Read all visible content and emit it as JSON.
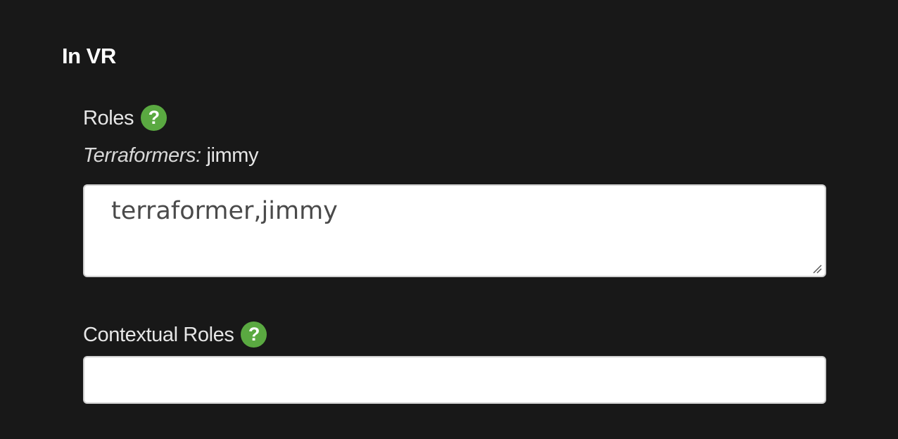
{
  "section": {
    "title": "In VR"
  },
  "roles": {
    "label": "Roles",
    "help_icon": "question-mark-icon",
    "current": {
      "group_label": "Terraformers:",
      "value": "jimmy"
    },
    "textarea_value": "terraformer,jimmy"
  },
  "contextual_roles": {
    "label": "Contextual Roles",
    "help_icon": "question-mark-icon",
    "input_value": ""
  },
  "colors": {
    "background": "#181818",
    "help_icon": "#5aa941",
    "field_background": "#ffffff"
  }
}
